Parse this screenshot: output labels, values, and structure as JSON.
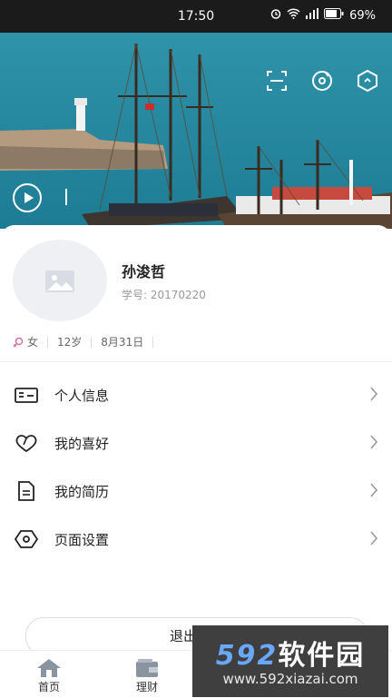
{
  "status_bar": {
    "time": "17:50",
    "battery": "69%",
    "icons": [
      "alarm-icon",
      "wifi-icon",
      "signal-icon",
      "battery-icon"
    ]
  },
  "hero": {
    "icons": [
      "scan-icon",
      "music-disc-icon",
      "hexagon-settings-icon",
      "play-icon"
    ]
  },
  "profile": {
    "name": "孙浚哲",
    "student_id": "学号: 20170220",
    "gender": "女",
    "age": "12岁",
    "birthday": "8月31日"
  },
  "menu": [
    {
      "label": "个人信息",
      "icon": "id-card-icon"
    },
    {
      "label": "我的喜好",
      "icon": "heart-icon"
    },
    {
      "label": "我的简历",
      "icon": "document-icon"
    },
    {
      "label": "页面设置",
      "icon": "hexagon-eye-icon"
    }
  ],
  "logout": {
    "label": "退出登录"
  },
  "tabs": [
    {
      "label": "首页",
      "icon": "home-icon"
    },
    {
      "label": "理财",
      "icon": "wallet-icon"
    }
  ],
  "watermark": {
    "brand_num": "592",
    "brand_text": "软件园",
    "url": "www.592xiazai.com"
  }
}
